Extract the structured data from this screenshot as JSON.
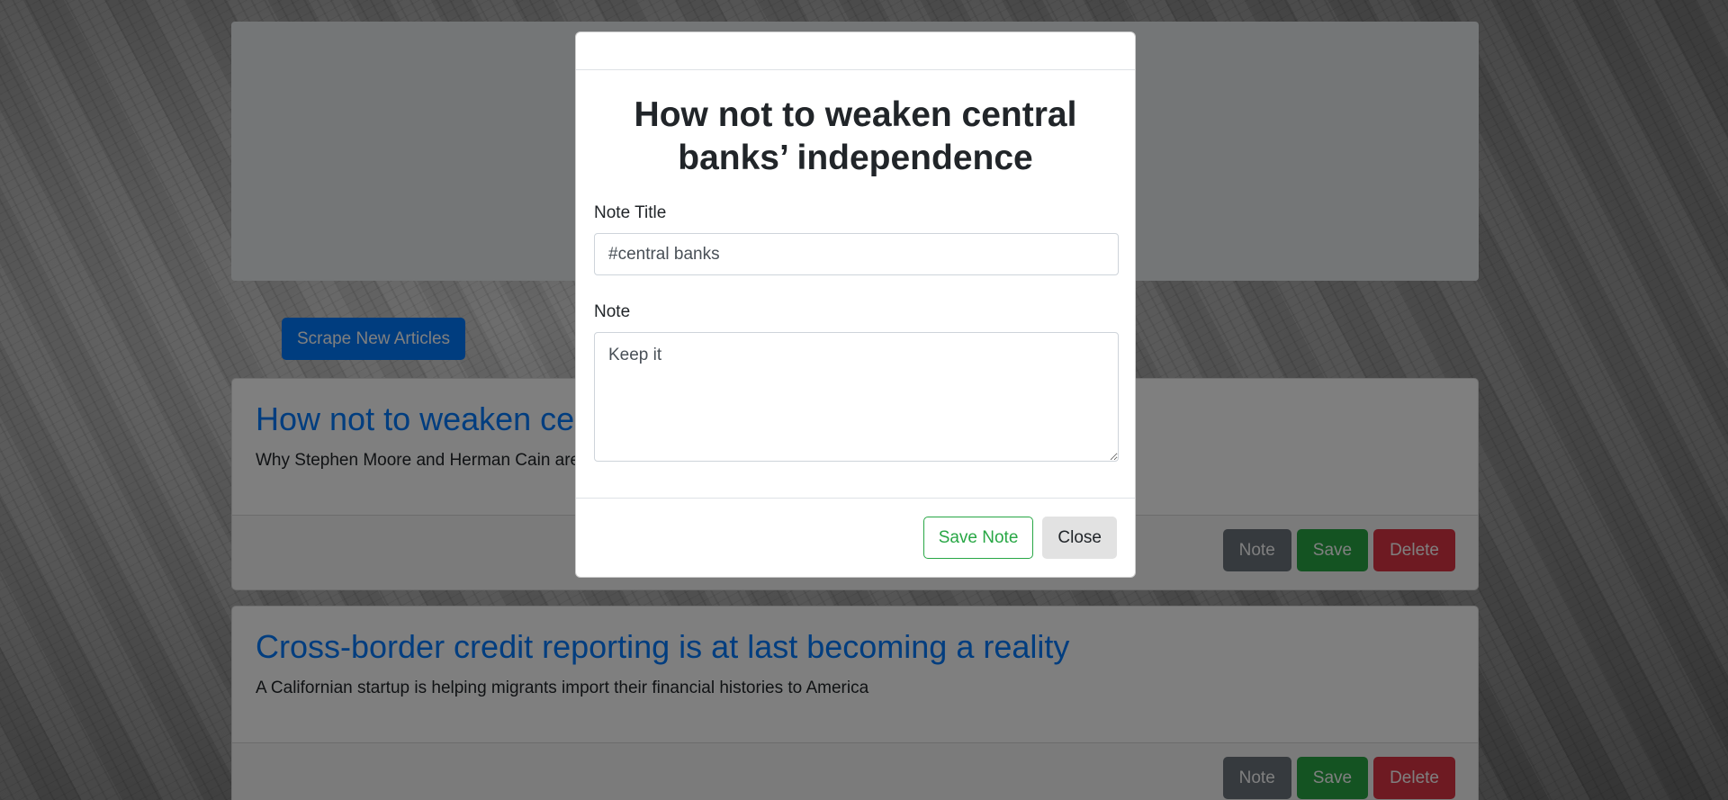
{
  "page": {
    "scrape_button": "Scrape New Articles"
  },
  "articles": [
    {
      "title": "How not to weaken central banks’ independence",
      "summary": "Why Stephen Moore and Herman Cain are bad choices for the Fed",
      "note_label": "Note",
      "save_label": "Save",
      "delete_label": "Delete"
    },
    {
      "title": "Cross-border credit reporting is at last becoming a reality",
      "summary": "A Californian startup is helping migrants import their financial histories to America",
      "note_label": "Note",
      "save_label": "Save",
      "delete_label": "Delete"
    }
  ],
  "modal": {
    "title": "How not to weaken central banks’ independence",
    "note_title_label": "Note Title",
    "note_title_value": "#central banks",
    "note_label": "Note",
    "note_value": "Keep it",
    "save_note_button": "Save Note",
    "close_button": "Close"
  },
  "colors": {
    "primary": "#007bff",
    "secondary": "#6c757d",
    "success": "#28a745",
    "danger": "#dc3545"
  }
}
